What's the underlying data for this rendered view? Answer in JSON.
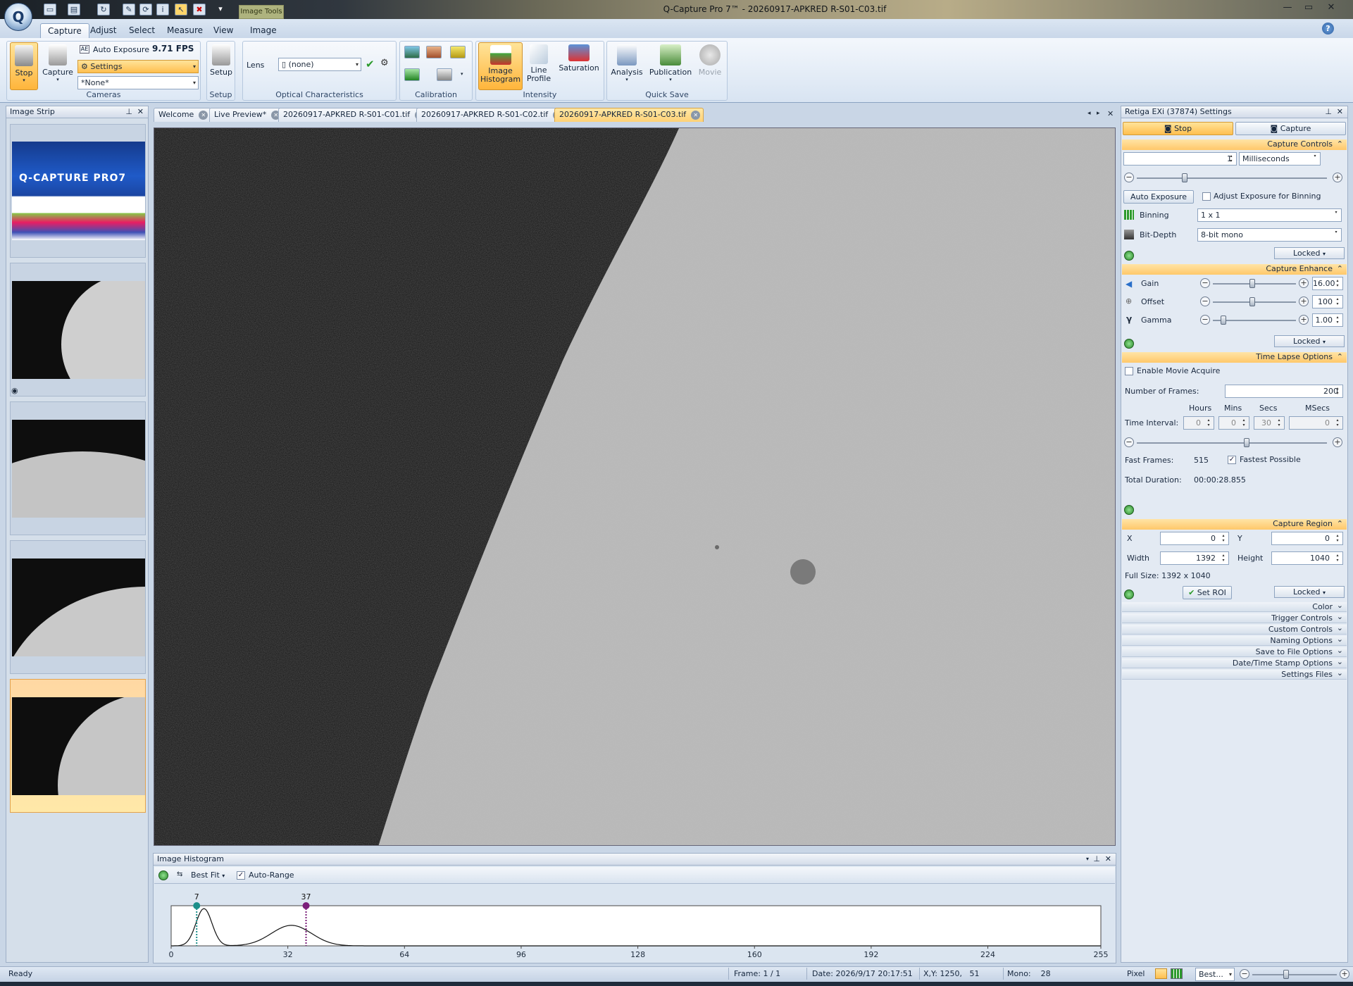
{
  "window": {
    "title": "Q-Capture Pro 7™ - 20260917-APKRED R-S01-C03.tif",
    "context_tab": "Image Tools"
  },
  "ribbon": {
    "tabs": [
      "Capture",
      "Adjust",
      "Select",
      "Measure",
      "View",
      "Image"
    ],
    "cameras": {
      "stop": "Stop",
      "capture": "Capture",
      "auto_exposure": "Auto Exposure",
      "fps": "9.71 FPS",
      "settings": "Settings",
      "none": "*None*",
      "label": "Cameras"
    },
    "setup": {
      "button": "Setup",
      "label": "Setup"
    },
    "optical": {
      "lens": "Lens",
      "lens_value": "(none)",
      "label": "Optical Characteristics"
    },
    "calibration": {
      "label": "Calibration"
    },
    "intensity": {
      "histogram": "Image Histogram",
      "line_profile": "Line Profile",
      "saturation": "Saturation",
      "label": "Intensity"
    },
    "quicksave": {
      "analysis": "Analysis",
      "publication": "Publication",
      "movie": "Movie",
      "label": "Quick Save"
    }
  },
  "strip": {
    "title": "Image Strip",
    "logo_text": "Q-CAPTURE PRO7"
  },
  "doctabs": [
    "Welcome",
    "Live Preview*",
    "20260917-APKRED R-S01-C01.tif",
    "20260917-APKRED R-S01-C02.tif",
    "20260917-APKRED R-S01-C03.tif"
  ],
  "histogram": {
    "title": "Image Histogram",
    "best_fit": "Best Fit",
    "auto_range": "Auto-Range",
    "black_point": "7",
    "white_point": "37",
    "ticks": [
      "0",
      "32",
      "64",
      "96",
      "128",
      "160",
      "192",
      "224",
      "255"
    ],
    "chart_data": {
      "type": "line",
      "x_range": [
        0,
        255
      ],
      "black_point": 7,
      "white_point": 37,
      "peaks": [
        {
          "center": 9,
          "relative_height": 1.0
        },
        {
          "center": 33,
          "relative_height": 0.55
        }
      ]
    }
  },
  "settings": {
    "title": "Retiga EXi (37874) Settings",
    "stop_tab": "Stop",
    "capture_tab": "Capture",
    "capture_controls": {
      "header": "Capture Controls",
      "exposure_value": "1",
      "exposure_unit": "Milliseconds",
      "auto_exposure": "Auto Exposure",
      "adjust_binning": "Adjust Exposure for Binning",
      "binning_label": "Binning",
      "binning_value": "1 x 1",
      "bitdepth_label": "Bit-Depth",
      "bitdepth_value": "8-bit mono",
      "locked": "Locked"
    },
    "capture_enhance": {
      "header": "Capture Enhance",
      "gain_label": "Gain",
      "gain_value": "16.00",
      "offset_label": "Offset",
      "offset_value": "100",
      "gamma_label": "Gamma",
      "gamma_value": "1.00",
      "locked": "Locked"
    },
    "time_lapse": {
      "header": "Time Lapse Options",
      "enable_movie": "Enable Movie Acquire",
      "frames_label": "Number of Frames:",
      "frames_value": "200",
      "hours": "Hours",
      "mins": "Mins",
      "secs": "Secs",
      "msecs": "MSecs",
      "interval_label": "Time Interval:",
      "hours_value": "0",
      "mins_value": "0",
      "secs_value": "30",
      "msecs_value": "0",
      "fast_frames_label": "Fast Frames:",
      "fast_frames_value": "515",
      "fastest": "Fastest Possible",
      "duration_label": "Total Duration:",
      "duration_value": "00:00:28.855"
    },
    "capture_region": {
      "header": "Capture Region",
      "x_label": "X",
      "x_value": "0",
      "y_label": "Y",
      "y_value": "0",
      "width_label": "Width",
      "width_value": "1392",
      "height_label": "Height",
      "height_value": "1040",
      "full_size": "Full Size: 1392 x 1040",
      "set_roi": "Set ROI",
      "locked": "Locked"
    },
    "collapsed": [
      "Color",
      "Trigger Controls",
      "Custom Controls",
      "Naming Options",
      "Save to File Options",
      "Date/Time Stamp Options",
      "Settings Files"
    ]
  },
  "status": {
    "ready": "Ready",
    "frame": "Frame: 1 / 1",
    "date": "Date: 2026/9/17 20:17:51",
    "xy": "X,Y: 1250,   51",
    "mono": "Mono:    28",
    "pixel": "Pixel",
    "best": "Best..."
  }
}
